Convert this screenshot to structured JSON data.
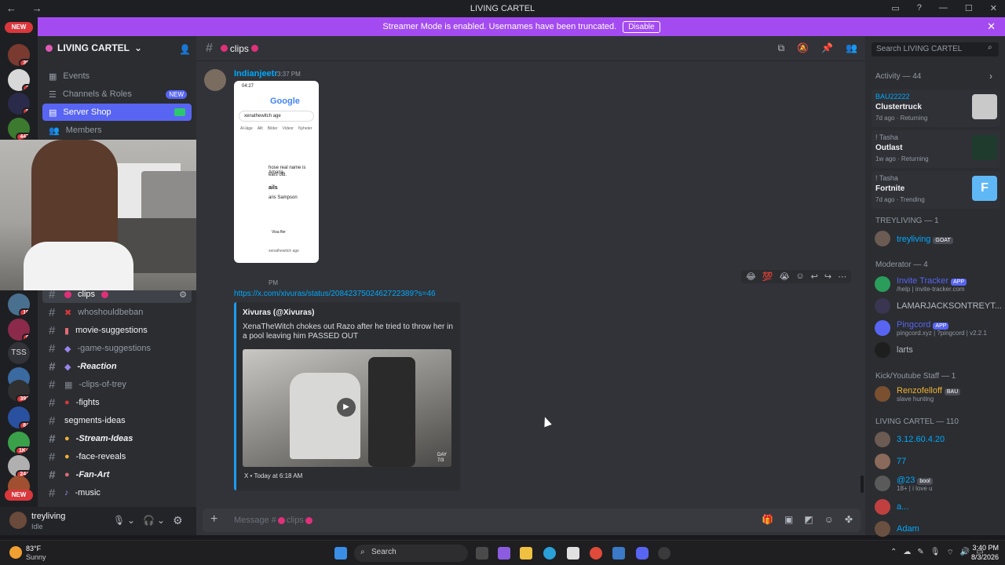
{
  "window": {
    "title": "LIVING CARTEL"
  },
  "banner": {
    "text": "Streamer Mode is enabled. Usernames have been truncated.",
    "button": "Disable"
  },
  "servers": {
    "new_top": "NEW",
    "new_bottom": "NEW",
    "badges": [
      "39",
      "2",
      "5",
      "447",
      "10",
      "6",
      "392",
      "84",
      "1K+",
      "244"
    ],
    "tss": "TSS"
  },
  "sidebar": {
    "guild_name": "LIVING CARTEL",
    "top_items": [
      {
        "label": "Events"
      },
      {
        "label": "Channels & Roles",
        "badge": "NEW"
      },
      {
        "label": "Server Shop"
      },
      {
        "label": "Members"
      }
    ],
    "channels": [
      {
        "label": "clips",
        "selected": true
      },
      {
        "label": "whoshouldbeban"
      },
      {
        "label": "movie-suggestions"
      },
      {
        "label": "-game-suggestions"
      },
      {
        "label": "-Reaction"
      },
      {
        "label": "-clips-of-trey"
      },
      {
        "label": "-fights"
      },
      {
        "label": "segments-ideas"
      },
      {
        "label": "-Stream-Ideas"
      },
      {
        "label": "-face-reveals"
      },
      {
        "label": "-Fan-Art"
      },
      {
        "label": "-music"
      }
    ]
  },
  "user": {
    "name": "treyliving",
    "status": "Idle"
  },
  "chat": {
    "channel": "clips",
    "messages": [
      {
        "author": "Indianjeetr",
        "time": "3:37 PM"
      }
    ],
    "phone": {
      "time": "04:27",
      "search_value": "xenathewitch age",
      "tabs": [
        "AI-läge",
        "Allt",
        "Bilder",
        "Videor",
        "Nyheter"
      ],
      "line1": "hose real name is Amaria",
      "line2": "ears old.",
      "details": "ails",
      "name": "aris Sampson",
      "more": "Visa fler",
      "footer": "xenathewitch age"
    },
    "link": "https://x.com/xivuras/status/2084237502462722389?s=46",
    "embed": {
      "author": "Xivuras (@Xivuras)",
      "text": "XenaTheWitch chokes out Razo after he tried to throw her in a pool leaving him PASSED OUT",
      "footer": "X • Today at 6:18 AM",
      "day_label": "DAY 7/3"
    },
    "composer_placeholder": "Message #",
    "composer_channel": "clips",
    "time_fragment": "PM"
  },
  "members": {
    "search_placeholder": "Search LIVING CARTEL",
    "activity_header": "Activity — 44",
    "activities": [
      {
        "user": "BAU22222",
        "game": "Clustertruck",
        "meta": "7d ago · Returning",
        "color": "#c9c9c9"
      },
      {
        "user": "! Tasha",
        "game": "Outlast",
        "meta": "1w ago · Returning",
        "color": "#1f3b2e"
      },
      {
        "user": "! Tasha",
        "game": "Fortnite",
        "meta": "7d ago · Trending",
        "color": "#5fb8f5"
      }
    ],
    "groups": [
      {
        "title": "TREYLIVING — 1",
        "members": [
          {
            "name": "treyliving",
            "tag": "GOAT",
            "color": "#00a8fc"
          }
        ]
      },
      {
        "title": "Moderator — 4",
        "members": [
          {
            "name": "Invite Tracker",
            "tag": "APP",
            "sub": "/help | invite-tracker.com",
            "color": "#5865f2"
          },
          {
            "name": "LAMARJACKSONTREYT...",
            "color": "#b5bac1"
          },
          {
            "name": "Pingcord",
            "tag": "APP",
            "sub": "pingcord.xyz | ?pingcord | v2.2.1",
            "color": "#5865f2"
          },
          {
            "name": "larts",
            "color": "#b5bac1"
          }
        ]
      },
      {
        "title": "Kick/Youtube Staff — 1",
        "members": [
          {
            "name": "Renzofelloff",
            "tag": "BAU",
            "sub": "slave hunting",
            "color": "#f0b232"
          }
        ]
      },
      {
        "title": "LIVING CARTEL — 110",
        "members": [
          {
            "name": "3.12.60.4.20",
            "color": "#00a8fc"
          },
          {
            "name": "77",
            "color": "#00a8fc"
          },
          {
            "name": "@23",
            "tag": "bool",
            "sub": "18+ | i love u",
            "color": "#00a8fc"
          },
          {
            "name": "a...",
            "color": "#00a8fc"
          },
          {
            "name": "Adam",
            "color": "#00a8fc"
          }
        ]
      }
    ]
  },
  "taskbar": {
    "weather_temp": "83°F",
    "weather_desc": "Sunny",
    "search": "Search",
    "time": "3:40 PM",
    "date": "8/3/2026"
  }
}
